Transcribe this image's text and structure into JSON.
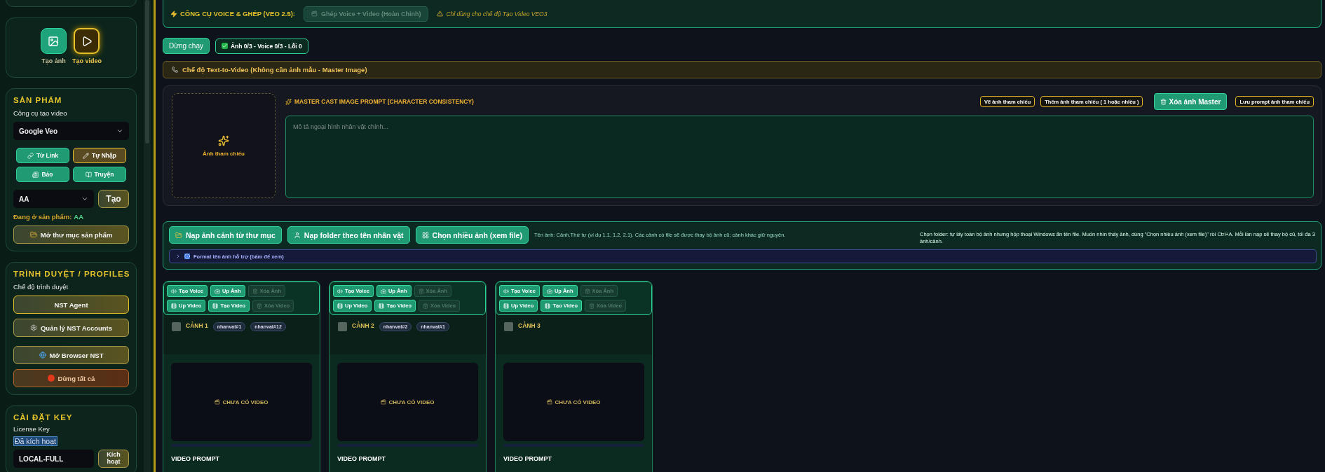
{
  "sidebar": {
    "modes": [
      {
        "label": "Tạo ảnh",
        "kind": "image",
        "selected": false
      },
      {
        "label": "Tạo video",
        "kind": "video",
        "selected": true
      }
    ],
    "product": {
      "title": "SẢN PHẨM",
      "tool_label": "Công cụ tạo video",
      "tool_value": "Google Veo",
      "sources": [
        {
          "label": "Từ Link",
          "kind": "link",
          "selected": false
        },
        {
          "label": "Tự Nhập",
          "kind": "pencil",
          "selected": true
        },
        {
          "label": "Báo",
          "kind": "news",
          "selected": false
        },
        {
          "label": "Truyện",
          "kind": "book",
          "selected": false
        }
      ],
      "product_value": "AA",
      "create_button": "Tạo",
      "current_label": "Đang ở sản phẩm:",
      "current_value": "AA",
      "open_folder": "Mở thư mục sản phẩm"
    },
    "browser": {
      "title": "TRÌNH DUYỆT / PROFILES",
      "mode_label": "Chế độ trình duyệt",
      "mode_button": {
        "label": "NST Agent",
        "selected": true
      },
      "buttons": [
        {
          "label": "Quản lý NST Accounts",
          "kind": "gear"
        },
        {
          "label": "Mở Browser NST",
          "kind": "globe"
        },
        {
          "label": "Dừng tất cả",
          "kind": "stop"
        }
      ]
    },
    "key": {
      "title": "CÀI ĐẶT KEY",
      "license_label": "License Key",
      "status": "Đã kích hoạt",
      "value": "LOCAL-FULL",
      "activate": "Kích hoạt"
    }
  },
  "voice_tools": {
    "title": "CÔNG CỤ VOICE & GHÉP (VEO 2.5):",
    "merge_button": {
      "label": "Ghép Voice + Video (Hoàn Chỉnh)",
      "disabled": true
    },
    "note": "Chỉ dùng cho chế độ Tạo Video VEO3"
  },
  "run_bar": {
    "stop": "Dừng chạy",
    "status": "Ảnh 0/3 - Voice 0/3 - Lỗi 0"
  },
  "mode_banner": "Chế độ Text-to-Video (Không cần ảnh mẫu - Master Image)",
  "master": {
    "reference_label": "Ảnh tham chiếu",
    "title": "MASTER CAST IMAGE PROMPT (CHARACTER CONSISTENCY)",
    "actions": [
      {
        "label": "Vẽ ảnh tham chiếu",
        "kind": "outline"
      },
      {
        "label": "Thêm ảnh tham chiếu ( 1 hoặc nhiều )",
        "kind": "outline"
      },
      {
        "label": "Xóa ảnh Master",
        "kind": "solid"
      },
      {
        "label": "Lưu prompt ảnh tham chiếu",
        "kind": "outline"
      }
    ],
    "placeholder": "Mô tả ngoại hình nhân vật chính..."
  },
  "import": {
    "buttons": [
      {
        "label": "Nạp ảnh cảnh từ thư mục",
        "kind": "folder"
      },
      {
        "label": "Nạp folder theo tên nhân vật",
        "kind": "person"
      },
      {
        "label": "Chọn nhiều ảnh (xem file)",
        "kind": "grid"
      }
    ],
    "hint": "Tên ảnh: Cảnh.Thứ tự (ví dụ 1.1, 1.2, 2.1). Các cảnh có file sẽ được thay bộ ảnh cũ; cảnh khác giữ nguyên.",
    "folder_note": "Chọn folder: tự lấy toàn bộ ảnh nhưng hộp thoại Windows ẩn tên file. Muốn nhìn thấy ảnh, dùng \"Chọn nhiều ảnh (xem file)\" rồi Ctrl+A. Mỗi lần nạp sẽ thay bộ cũ, tối đa 3 ảnh/cảnh.",
    "format_toggle": {
      "label": "Format tên ảnh hỗ trợ (bấm để xem)",
      "expanded": false
    }
  },
  "scenes": [
    {
      "title": "CẢNH 1",
      "checked": false,
      "tags": [
        "nhanvat#1",
        "nhanvat#12"
      ],
      "action_rows": [
        [
          {
            "label": "Tạo Voice",
            "kind": "voice",
            "disabled": false
          },
          {
            "label": "Up Ảnh",
            "kind": "camera",
            "disabled": false
          },
          {
            "label": "Xóa Ảnh",
            "kind": "trash",
            "disabled": true
          }
        ],
        [
          {
            "label": "Up Video",
            "kind": "film",
            "disabled": false
          },
          {
            "label": "Tạo Video",
            "kind": "film",
            "disabled": false
          },
          {
            "label": "Xóa Video",
            "kind": "trash",
            "disabled": true
          }
        ]
      ],
      "video_status": "CHƯA CÓ VIDEO",
      "progress": {
        "level": 0
      },
      "prompt_label": "VIDEO PROMPT"
    },
    {
      "title": "CẢNH 2",
      "checked": false,
      "tags": [
        "nhanvat#2",
        "nhanvat#1"
      ],
      "action_rows": [
        [
          {
            "label": "Tạo Voice",
            "kind": "voice",
            "disabled": false
          },
          {
            "label": "Up Ảnh",
            "kind": "camera",
            "disabled": false
          },
          {
            "label": "Xóa Ảnh",
            "kind": "trash",
            "disabled": true
          }
        ],
        [
          {
            "label": "Up Video",
            "kind": "film",
            "disabled": false
          },
          {
            "label": "Tạo Video",
            "kind": "film",
            "disabled": false
          },
          {
            "label": "Xóa Video",
            "kind": "trash",
            "disabled": true
          }
        ]
      ],
      "video_status": "CHƯA CÓ VIDEO",
      "progress": {
        "level": 0
      },
      "prompt_label": "VIDEO PROMPT"
    },
    {
      "title": "CẢNH 3",
      "checked": false,
      "action_rows": [
        [
          {
            "label": "Tạo Voice",
            "kind": "voice",
            "disabled": false
          },
          {
            "label": "Up Ảnh",
            "kind": "camera",
            "disabled": false
          },
          {
            "label": "Xóa Ảnh",
            "kind": "trash",
            "disabled": true
          }
        ],
        [
          {
            "label": "Up Video",
            "kind": "film",
            "disabled": false
          },
          {
            "label": "Tạo Video",
            "kind": "film",
            "disabled": false
          },
          {
            "label": "Xóa Video",
            "kind": "trash",
            "disabled": true
          }
        ]
      ],
      "video_status": "CHƯA CÓ VIDEO",
      "progress": {
        "level": 0
      },
      "prompt_label": "VIDEO PROMPT"
    }
  ]
}
